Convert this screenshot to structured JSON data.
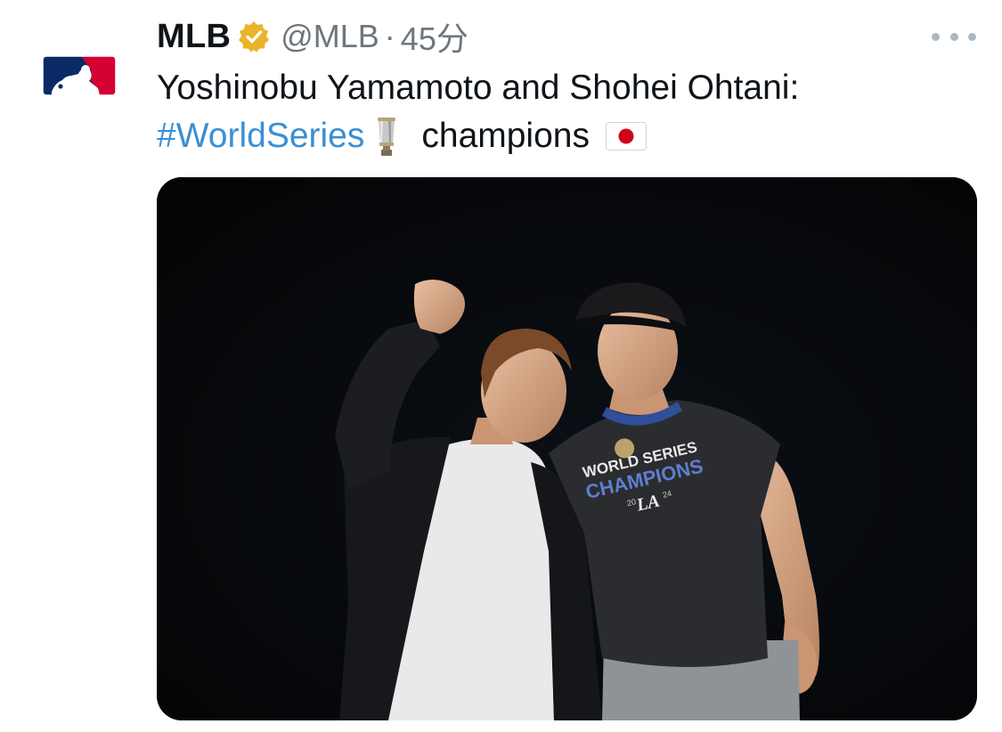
{
  "tweet": {
    "author": {
      "display_name": "MLB",
      "handle": "@MLB",
      "verified": true,
      "verified_icon": "verified-badge-icon",
      "avatar": "mlb-logo"
    },
    "separator": "·",
    "timestamp": "45分",
    "more_icon": "more-options-icon",
    "text": {
      "line1": "Yoshinobu Yamamoto and Shohei Ohtani:",
      "hashtag": "#WorldSeries",
      "line2_rest": "champions",
      "emoji": [
        "trophy-icon",
        "japan-flag-icon"
      ]
    },
    "media": {
      "shirt": {
        "line1": "WORLD SERIES",
        "line2": "CHAMPIONS",
        "year_left": "20",
        "year_right": "24",
        "logo": "LA"
      }
    }
  },
  "colors": {
    "text": "#0f1419",
    "secondary": "#6e767d",
    "link": "#3b8fd3",
    "verified_gold": "#e8b52a",
    "mlb_blue": "#0a2a66",
    "mlb_red": "#d50032"
  }
}
